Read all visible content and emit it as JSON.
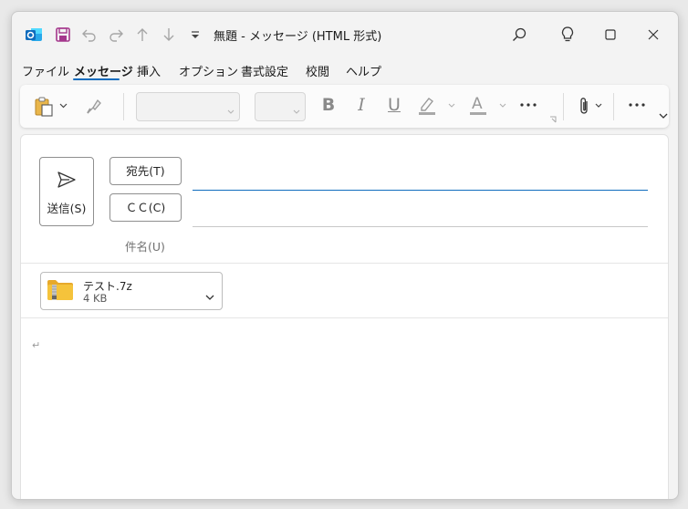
{
  "window": {
    "title": "無題  -  メッセージ (HTML 形式)"
  },
  "titlebar": {
    "icons": [
      "outlook-app-icon",
      "save-icon",
      "undo-icon",
      "redo-icon",
      "up-arrow-icon",
      "down-arrow-icon",
      "customize-toolbar-icon"
    ],
    "right_icons": [
      "search-icon",
      "lightbulb-icon",
      "maximize-icon",
      "close-icon"
    ]
  },
  "menu": {
    "items": [
      "ファイル",
      "メッセージ",
      "挿入",
      "オプション",
      "書式設定",
      "校閲",
      "ヘルプ"
    ],
    "active": "メッセージ"
  },
  "ribbon": {
    "tools": [
      "paste-icon",
      "format-painter-icon",
      "font-name-dropdown",
      "font-size-dropdown",
      "bold-icon",
      "italic-icon",
      "underline-icon",
      "highlight-icon",
      "font-color-icon",
      "more-icon",
      "attach-icon",
      "more-commands-icon",
      "collapse-ribbon-icon"
    ],
    "bold": "B",
    "italic": "I",
    "underline": "U",
    "font_color": "A"
  },
  "compose": {
    "send_label": "送信(S)",
    "to_label": "宛先(T)",
    "cc_label": "ＣＣ(C)",
    "subject_label": "件名(U)",
    "to_value": "",
    "cc_value": "",
    "subject_value": "",
    "body_mark": "↵"
  },
  "attachment": {
    "name": "テスト.7z",
    "size": "4 KB",
    "icon": "zip-folder-icon"
  },
  "colors": {
    "accent": "#0f6cbd",
    "save_icon": "#a4378c",
    "folder": "#f5c33b"
  }
}
